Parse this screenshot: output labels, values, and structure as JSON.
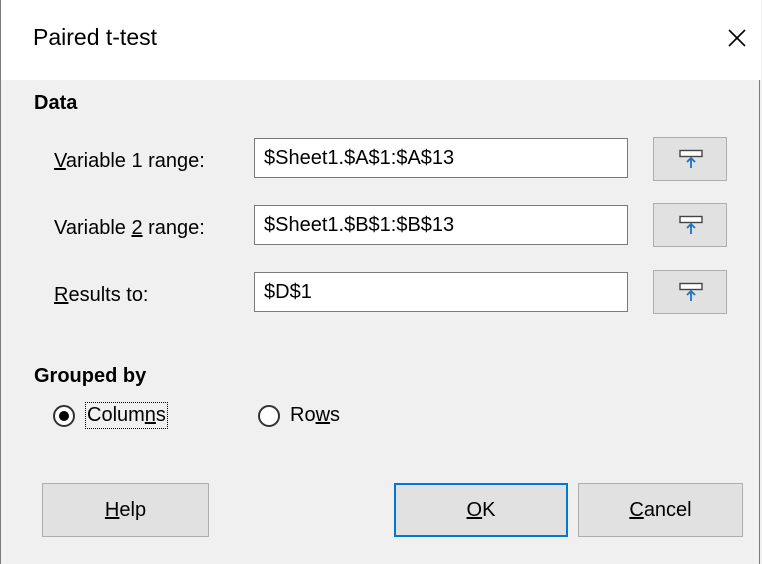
{
  "dialog": {
    "title": "Paired t-test",
    "close_glyph": "✕"
  },
  "data_section": {
    "title": "Data",
    "variable1": {
      "label_pre": "",
      "label_key": "V",
      "label_post": "ariable 1 range:",
      "value": "$Sheet1.$A$1:$A$13"
    },
    "variable2": {
      "label_pre": "Variable ",
      "label_key": "2",
      "label_post": " range:",
      "value": "$Sheet1.$B$1:$B$13"
    },
    "results": {
      "label_pre": "",
      "label_key": "R",
      "label_post": "esults to:",
      "value": "$D$1"
    },
    "shrink_icon": "shrink-range-icon"
  },
  "grouped_section": {
    "title": "Grouped by",
    "columns": {
      "pre": "Colum",
      "key": "n",
      "post": "s",
      "selected": true
    },
    "rows": {
      "pre": "Ro",
      "key": "w",
      "post": "s",
      "selected": false
    }
  },
  "buttons": {
    "help": {
      "key": "H",
      "post": "elp"
    },
    "ok": {
      "key": "O",
      "post": "K"
    },
    "cancel": {
      "key": "C",
      "post": "ancel"
    }
  },
  "colors": {
    "accent": "#0078d7",
    "icon_blue": "#1e73be"
  }
}
